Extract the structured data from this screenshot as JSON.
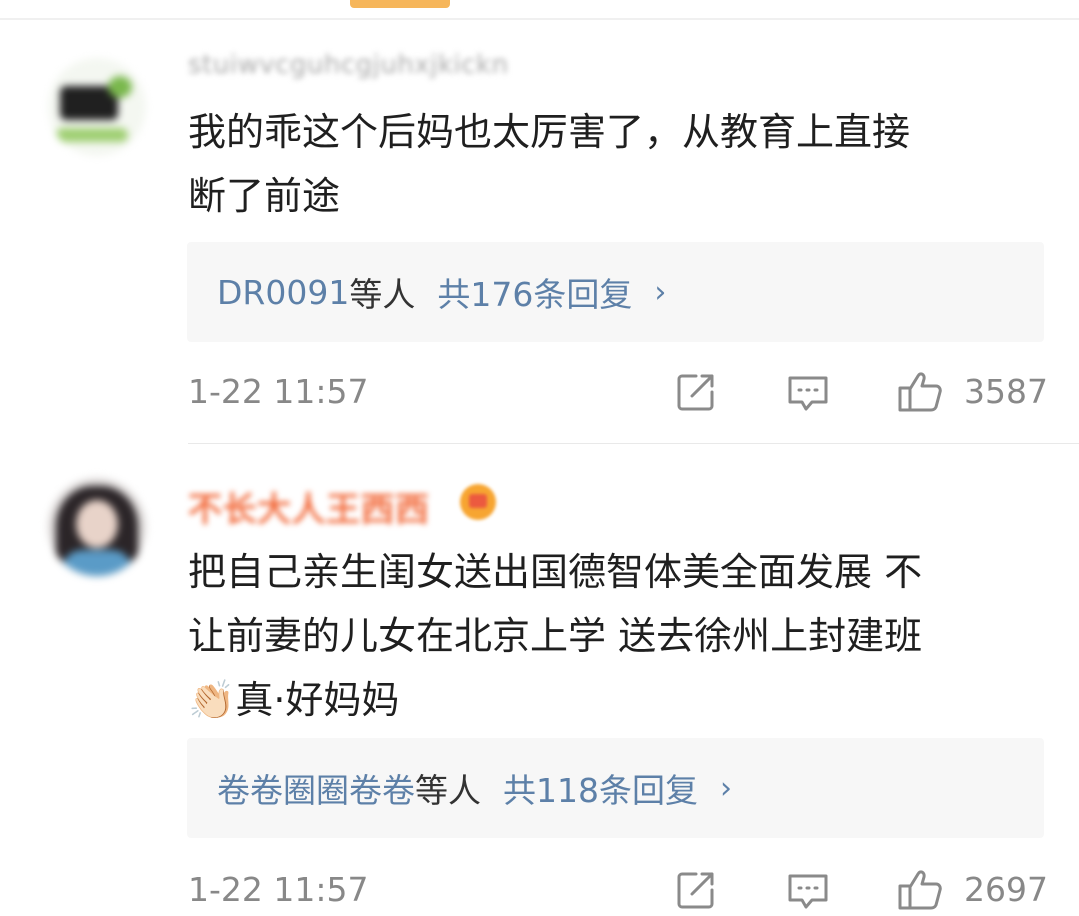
{
  "comments": [
    {
      "username": "stuiwvcguhcgjuhxjkickn",
      "text": "我的乖这个后妈也太厉害了，从教育上直接\n断了前途",
      "replies": {
        "replier": "DR0091",
        "etc": "等人",
        "count": "共176条回复",
        "chevron": "›"
      },
      "time": "1-22 11:57",
      "likes": "3587"
    },
    {
      "username": "不长大人王西西",
      "text": "把自己亲生闺女送出国德智体美全面发展 不\n让前妻的儿女在北京上学 送去徐州上封建班\n👏🏻真·好妈妈",
      "replies": {
        "replier": "卷卷圈圈卷卷",
        "etc": "等人",
        "count": "共118条回复",
        "chevron": "›"
      },
      "time": "1-22 11:57",
      "likes": "2697"
    }
  ],
  "icons": {
    "share": "share-icon",
    "reply": "comment-icon",
    "like": "thumbs-up-icon",
    "vip": "vip-badge-icon"
  },
  "colors": {
    "link_blue": "#5d80a8",
    "meta_gray": "#888888",
    "vip_name": "#f26a3b",
    "reply_bg": "#f7f7f7",
    "accent_tab": "#f6b65b"
  }
}
